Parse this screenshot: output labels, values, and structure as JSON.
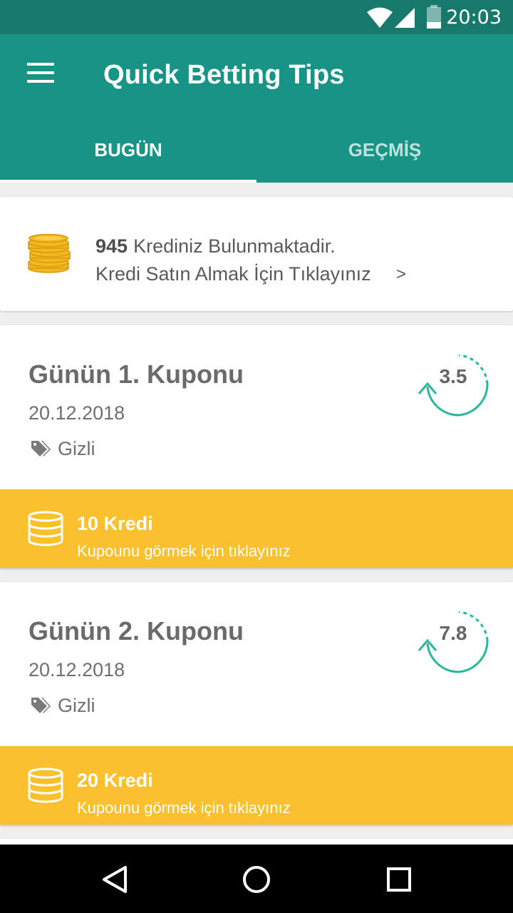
{
  "status_bar": {
    "time": "20:03",
    "icons": [
      "wifi-icon",
      "signal-icon",
      "battery-icon"
    ]
  },
  "app_bar": {
    "title": "Quick Betting Tips",
    "menu_icon": "hamburger-menu-icon"
  },
  "tabs": [
    {
      "label": "BUGÜN",
      "active": true
    },
    {
      "label": "GEÇMİŞ",
      "active": false
    }
  ],
  "credit_banner": {
    "amount": "945",
    "balance_text": "Krediniz Bulunmaktadir.",
    "buy_text": "Kredi Satın Almak İçin Tıklayınız",
    "chevron": ">"
  },
  "coupons": [
    {
      "title": "Günün 1. Kuponu",
      "date": "20.12.2018",
      "status": "Gizli",
      "odds": "3.5",
      "price_amount": "10",
      "price_unit": "Kredi",
      "cta": "Kupounu görmek için tıklayınız"
    },
    {
      "title": "Günün 2. Kuponu",
      "date": "20.12.2018",
      "status": "Gizli",
      "odds": "7.8",
      "price_amount": "20",
      "price_unit": "Kredi",
      "cta": "Kupounu görmek için tıklayınız"
    }
  ],
  "colors": {
    "primary": "#179485",
    "primary_dark": "#17796c",
    "accent_yellow": "#fbc02d",
    "teal_icon": "#26b89a"
  }
}
